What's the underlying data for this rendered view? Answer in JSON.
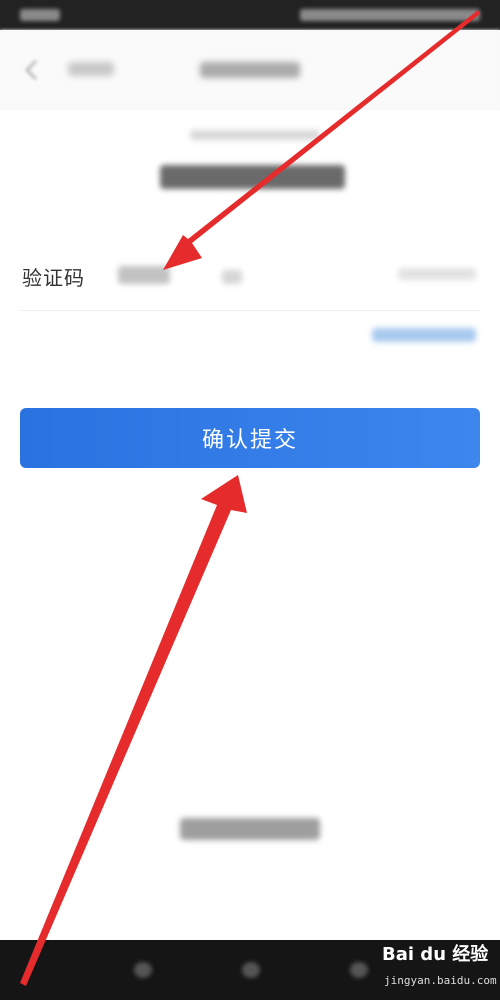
{
  "verify": {
    "code_label": "验证码"
  },
  "submit": {
    "label": "确认提交"
  },
  "watermark": {
    "brand": "Bai du 经验",
    "url": "jingyan.baidu.com"
  },
  "colors": {
    "button": "#2a72e0",
    "arrow": "#e52b2b"
  },
  "icons": {
    "back": "back-arrow-icon",
    "annotation": "red-arrow-annotation"
  }
}
